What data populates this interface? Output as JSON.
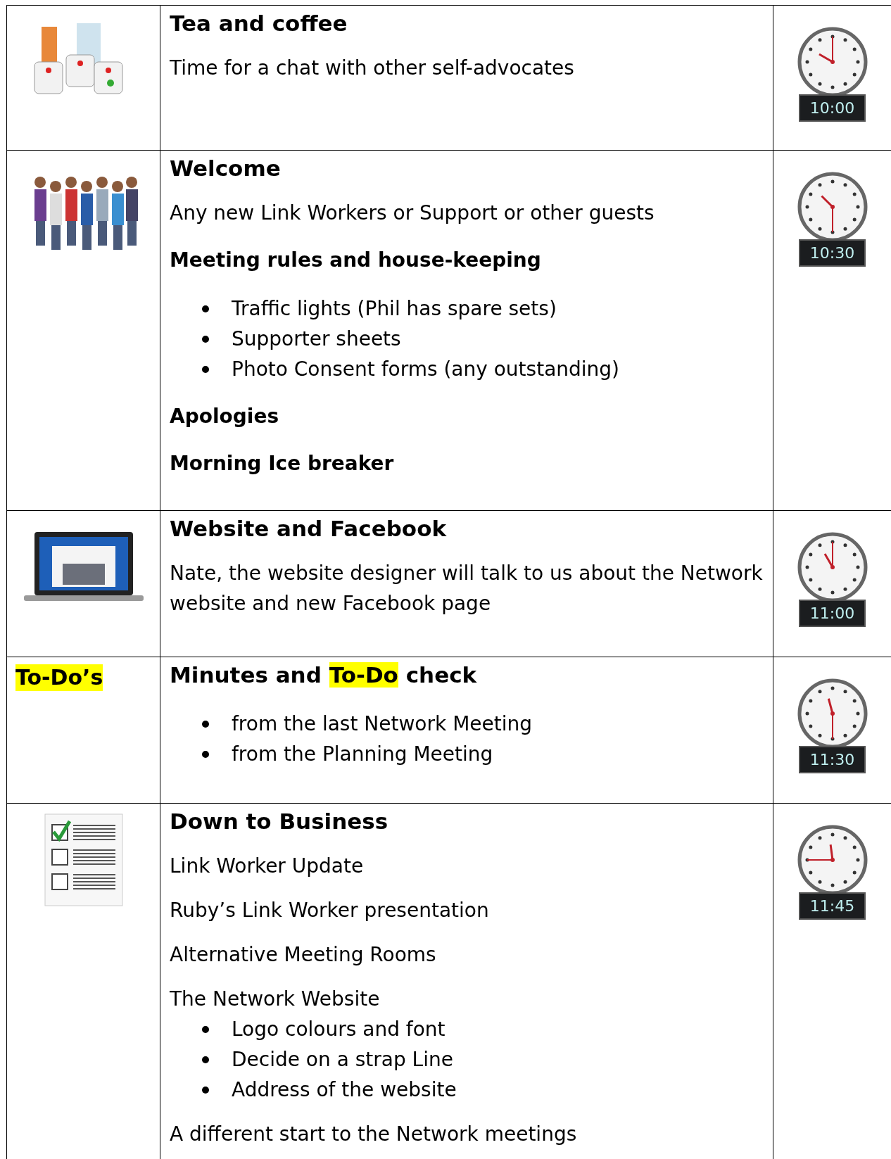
{
  "rows": [
    {
      "left": {
        "kind": "picture"
      },
      "time": "10:00",
      "blocks": [
        {
          "kind": "heading",
          "parts": [
            {
              "text": "Tea and coffee",
              "highlight": false
            }
          ]
        },
        {
          "kind": "text",
          "text": "Time for a chat with other self-advocates"
        }
      ]
    },
    {
      "left": {
        "kind": "picture"
      },
      "time": "10:30",
      "blocks": [
        {
          "kind": "heading",
          "parts": [
            {
              "text": "Welcome",
              "highlight": false
            }
          ]
        },
        {
          "kind": "text",
          "text": "Any new Link Workers or Support or other guests"
        },
        {
          "kind": "subheading",
          "text": "Meeting rules and house-keeping"
        },
        {
          "kind": "bullets",
          "items": [
            "Traffic lights (Phil has spare sets)",
            "Supporter sheets",
            "Photo Consent forms (any outstanding)"
          ]
        },
        {
          "kind": "subheading",
          "text": "Apologies"
        },
        {
          "kind": "subheading",
          "text": "Morning Ice breaker"
        }
      ]
    },
    {
      "left": {
        "kind": "picture"
      },
      "time": "11:00",
      "blocks": [
        {
          "kind": "heading",
          "parts": [
            {
              "text": "Website and Facebook",
              "highlight": false
            }
          ]
        },
        {
          "kind": "text",
          "text": "Nate, the website designer will talk to us about the Network website and new Facebook page"
        }
      ]
    },
    {
      "left": {
        "kind": "label",
        "text": "To-Do’s",
        "highlight": true
      },
      "time": "11:30",
      "blocks": [
        {
          "kind": "heading",
          "parts": [
            {
              "text": "Minutes and ",
              "highlight": false
            },
            {
              "text": "To-Do",
              "highlight": true
            },
            {
              "text": " check",
              "highlight": false
            }
          ]
        },
        {
          "kind": "bullets",
          "items": [
            "from the last Network Meeting",
            "from the Planning Meeting"
          ]
        }
      ]
    },
    {
      "left": {
        "kind": "picture"
      },
      "time": "11:45",
      "blocks": [
        {
          "kind": "heading",
          "parts": [
            {
              "text": "Down to Business",
              "highlight": false
            }
          ]
        },
        {
          "kind": "text",
          "text": "Link Worker Update"
        },
        {
          "kind": "text",
          "text": "Ruby’s Link Worker presentation"
        },
        {
          "kind": "text",
          "text": "Alternative Meeting Rooms"
        },
        {
          "kind": "text",
          "text": "The Network Website"
        },
        {
          "kind": "bullets",
          "items": [
            "Logo colours and font",
            "Decide on a strap Line",
            "Address of the website"
          ]
        },
        {
          "kind": "text",
          "text": "A different start to the Network meetings"
        }
      ]
    }
  ]
}
